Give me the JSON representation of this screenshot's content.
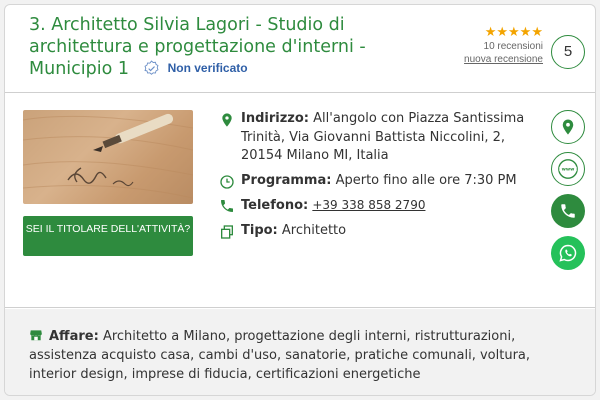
{
  "listing": {
    "title": "3. Architetto Silvia Lagori - Studio di architettura e progettazione d'interni - Municipio 1",
    "verified_label": "Non verificato",
    "stars": "★★★★★",
    "reviews_count": "10 recensioni",
    "new_review": "nuova recensione",
    "rank": "5",
    "owner_button": "SEI IL TITOLARE DELL'ATTIVITÀ?",
    "address_label": "Indirizzo:",
    "address_value": "All'angolo con Piazza Santissima Trinità, Via Giovanni Battista Niccolini, 2, 20154 Milano MI, Italia",
    "schedule_label": "Programma:",
    "schedule_value": "Aperto fino alle ore 7:30 PM",
    "phone_label": "Telefono:",
    "phone_value": "+39 338 858 2790",
    "type_label": "Tipo:",
    "type_value": "Architetto",
    "business_label": "Affare:",
    "business_value": "Architetto a Milano, progettazione degli interni, ristrutturazioni, assistenza acquisto casa, cambi d'uso, sanatorie, pratiche comunali, voltura, interior design, imprese di fiducia, certificazioni energetiche"
  },
  "icons": {
    "verified": "badge-check-icon",
    "address": "map-pin-icon",
    "schedule": "clock-icon",
    "phone": "phone-icon",
    "type": "copy-icon",
    "business": "store-icon",
    "action_map": "map-marker-icon",
    "action_web": "www-icon",
    "action_call": "phone-icon",
    "action_whatsapp": "whatsapp-icon"
  },
  "colors": {
    "accent": "#2e8b3e",
    "stars": "#f3a400",
    "verified": "#2f5fa7",
    "whatsapp": "#25c15a"
  }
}
